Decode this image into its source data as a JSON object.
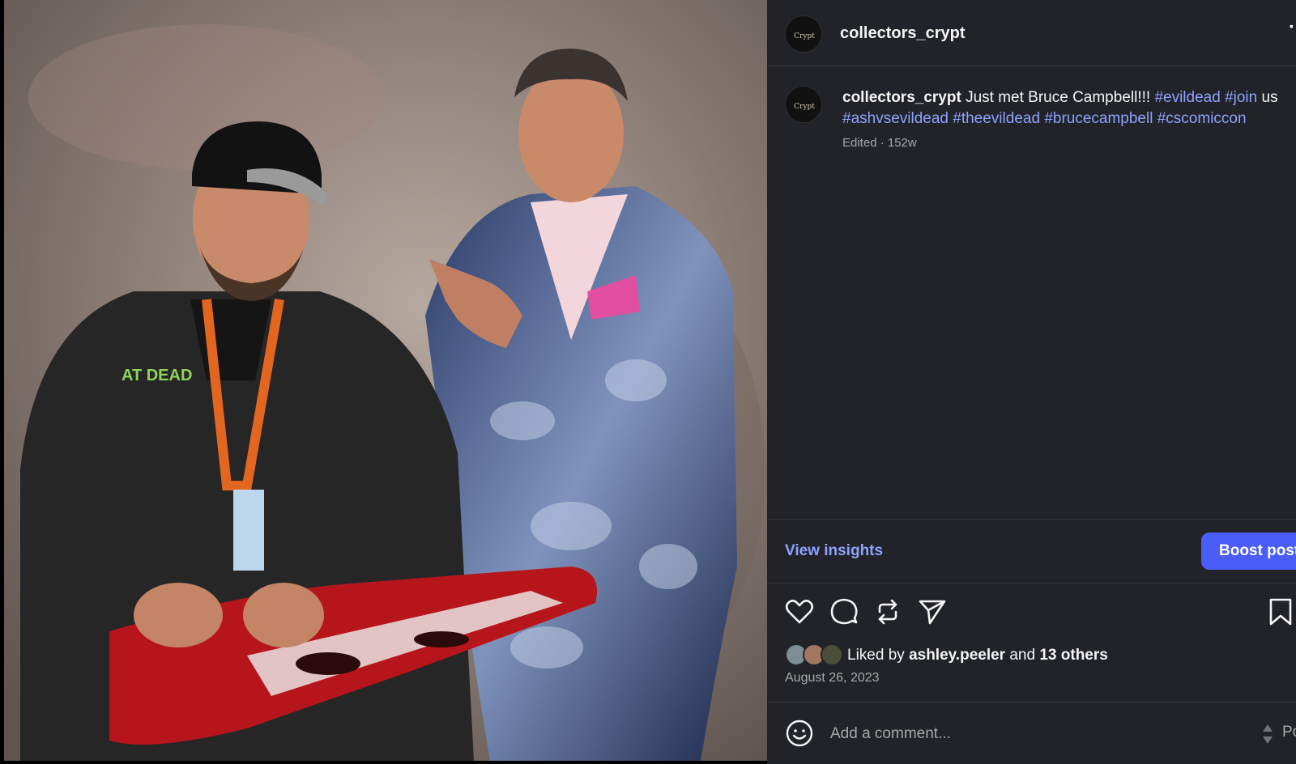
{
  "post": {
    "photo_alt": "collectors_crypt photo",
    "username": "collectors_crypt",
    "more_icon": "more-options-icon",
    "caption": {
      "username": "collectors_crypt",
      "text": "Just met Bruce Campbell!!!",
      "tags_line1": [
        "#evildead",
        "#join"
      ],
      "word_after": "us",
      "tags_line2": [
        "#ashvsevildead",
        "#theevildead",
        "#brucecampbell",
        "#cscomiccon"
      ]
    },
    "meta": "Edited · 152w"
  },
  "insights": {
    "view_label": "View insights",
    "boost_label": "Boost post"
  },
  "actions": {
    "icons": [
      "heart-icon",
      "comment-icon",
      "repost-icon",
      "share-icon",
      "bookmark-icon"
    ]
  },
  "likes": {
    "prefix": "Liked by",
    "user": "ashley.peeler",
    "and": "and",
    "others": "13 others"
  },
  "date": "August 26, 2023",
  "comment": {
    "placeholder": "Add a comment...",
    "post_label": "Post"
  },
  "colors": {
    "panel_bg": "#212328",
    "link": "#8ea2ff",
    "button": "#4a5df9",
    "muted": "#a8a8a8"
  }
}
